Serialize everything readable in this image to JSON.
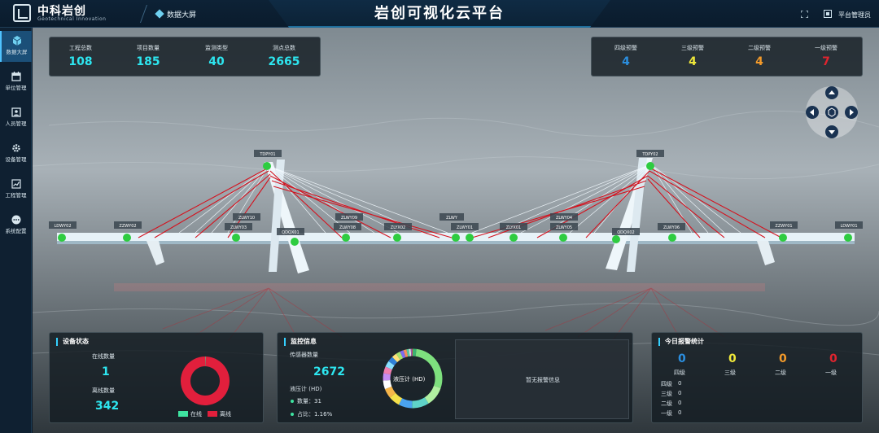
{
  "header": {
    "brand_name": "中科岩创",
    "brand_sub": "Geotechnical Innovation",
    "tab_label": "数据大屏",
    "title": "岩创可视化云平台",
    "user_name": "平台管理员"
  },
  "sidebar": {
    "items": [
      {
        "label": "数据大屏",
        "icon": "cube-icon",
        "active": true
      },
      {
        "label": "单位管理",
        "icon": "calendar-icon",
        "active": false
      },
      {
        "label": "人员管理",
        "icon": "person-card-icon",
        "active": false
      },
      {
        "label": "设备管理",
        "icon": "gear-icon",
        "active": false
      },
      {
        "label": "工程管理",
        "icon": "chart-icon",
        "active": false
      },
      {
        "label": "系统配置",
        "icon": "dots-icon",
        "active": false
      }
    ]
  },
  "top_stats": [
    {
      "label": "工程总数",
      "value": "108"
    },
    {
      "label": "项目数量",
      "value": "185"
    },
    {
      "label": "监测类型",
      "value": "40"
    },
    {
      "label": "测点总数",
      "value": "2665"
    }
  ],
  "alarm_stats": [
    {
      "label": "四级预警",
      "value": "4",
      "color": "#2b8fe0"
    },
    {
      "label": "三级预警",
      "value": "4",
      "color": "#f0e83a"
    },
    {
      "label": "二级预警",
      "value": "4",
      "color": "#f39a2a"
    },
    {
      "label": "一级预警",
      "value": "7",
      "color": "#e0242e"
    }
  ],
  "bridge_tags": [
    "TDPY01",
    "TDPY02",
    "LDWY02",
    "ZZWY02",
    "ZLWY10",
    "ZLWY03",
    "QDQX01",
    "ZLWY09",
    "ZLWY08",
    "ZLYX02",
    "ZLWY",
    "ZLWY01",
    "ZLYX01",
    "ZLWY04",
    "ZLWY05",
    "ZLWY06",
    "QDQX02",
    "ZZWY01",
    "LDWY01"
  ],
  "device_status": {
    "title": "设备状态",
    "online_label": "在线数量",
    "online_value": "1",
    "offline_label": "离线数量",
    "offline_value": "342",
    "legend_online": "在线",
    "legend_offline": "离线",
    "online_color": "#3ee3a0",
    "offline_color": "#e21f3c"
  },
  "monitor_info": {
    "title": "监控信息",
    "sensor_label": "传感器数量",
    "sensor_value": "2672",
    "type_label": "液压计 (HD)",
    "count_line": "数量：31",
    "ratio_line": "占比：1.16%",
    "donut_center": "液压计 (HD)",
    "no_alarm": "暂无报警信息"
  },
  "today_alarm": {
    "title": "今日报警统计",
    "levels": [
      {
        "label": "四级",
        "value": "0",
        "color": "#2b8fe0"
      },
      {
        "label": "三级",
        "value": "0",
        "color": "#f0e83a"
      },
      {
        "label": "二级",
        "value": "0",
        "color": "#f39a2a"
      },
      {
        "label": "一级",
        "value": "0",
        "color": "#e0242e"
      }
    ],
    "list": [
      {
        "label": "四级",
        "value": "0"
      },
      {
        "label": "三级",
        "value": "0"
      },
      {
        "label": "二级",
        "value": "0"
      },
      {
        "label": "一级",
        "value": "0"
      }
    ]
  },
  "chart_data": [
    {
      "type": "pie",
      "labels": [
        "在线",
        "离线"
      ],
      "values": [
        1,
        342
      ],
      "colors": [
        "#3ee3a0",
        "#e21f3c"
      ]
    },
    {
      "type": "pie",
      "values": [
        31,
        420,
        160,
        140,
        110,
        90,
        80,
        70,
        60,
        55,
        50,
        45,
        40,
        35,
        30,
        25,
        20,
        15,
        10,
        5
      ],
      "colors": [
        "#3cb371",
        "#7ee07e",
        "#b0f0a0",
        "#5fd3c8",
        "#4aa3f0",
        "#f5e04a",
        "#f7b64a",
        "#ffffff",
        "#c48cf2",
        "#f07fb0",
        "#89e0ff",
        "#2f7fd8",
        "#ffe27a",
        "#a6e36f",
        "#7c6cf0",
        "#f28e5b",
        "#56c9a0",
        "#e3e3e3",
        "#9b59b6",
        "#e74c3c"
      ]
    }
  ]
}
